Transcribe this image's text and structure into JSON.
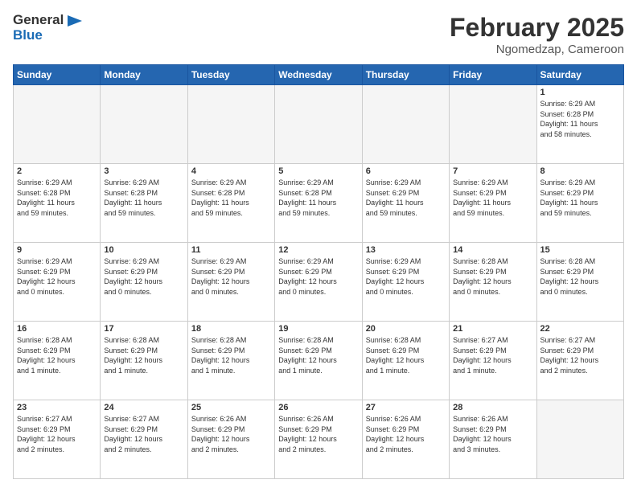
{
  "logo": {
    "line1": "General",
    "line2": "Blue"
  },
  "title": "February 2025",
  "location": "Ngomedzap, Cameroon",
  "days_header": [
    "Sunday",
    "Monday",
    "Tuesday",
    "Wednesday",
    "Thursday",
    "Friday",
    "Saturday"
  ],
  "weeks": [
    [
      {
        "day": "",
        "info": ""
      },
      {
        "day": "",
        "info": ""
      },
      {
        "day": "",
        "info": ""
      },
      {
        "day": "",
        "info": ""
      },
      {
        "day": "",
        "info": ""
      },
      {
        "day": "",
        "info": ""
      },
      {
        "day": "1",
        "info": "Sunrise: 6:29 AM\nSunset: 6:28 PM\nDaylight: 11 hours\nand 58 minutes."
      }
    ],
    [
      {
        "day": "2",
        "info": "Sunrise: 6:29 AM\nSunset: 6:28 PM\nDaylight: 11 hours\nand 59 minutes."
      },
      {
        "day": "3",
        "info": "Sunrise: 6:29 AM\nSunset: 6:28 PM\nDaylight: 11 hours\nand 59 minutes."
      },
      {
        "day": "4",
        "info": "Sunrise: 6:29 AM\nSunset: 6:28 PM\nDaylight: 11 hours\nand 59 minutes."
      },
      {
        "day": "5",
        "info": "Sunrise: 6:29 AM\nSunset: 6:28 PM\nDaylight: 11 hours\nand 59 minutes."
      },
      {
        "day": "6",
        "info": "Sunrise: 6:29 AM\nSunset: 6:29 PM\nDaylight: 11 hours\nand 59 minutes."
      },
      {
        "day": "7",
        "info": "Sunrise: 6:29 AM\nSunset: 6:29 PM\nDaylight: 11 hours\nand 59 minutes."
      },
      {
        "day": "8",
        "info": "Sunrise: 6:29 AM\nSunset: 6:29 PM\nDaylight: 11 hours\nand 59 minutes."
      }
    ],
    [
      {
        "day": "9",
        "info": "Sunrise: 6:29 AM\nSunset: 6:29 PM\nDaylight: 12 hours\nand 0 minutes."
      },
      {
        "day": "10",
        "info": "Sunrise: 6:29 AM\nSunset: 6:29 PM\nDaylight: 12 hours\nand 0 minutes."
      },
      {
        "day": "11",
        "info": "Sunrise: 6:29 AM\nSunset: 6:29 PM\nDaylight: 12 hours\nand 0 minutes."
      },
      {
        "day": "12",
        "info": "Sunrise: 6:29 AM\nSunset: 6:29 PM\nDaylight: 12 hours\nand 0 minutes."
      },
      {
        "day": "13",
        "info": "Sunrise: 6:29 AM\nSunset: 6:29 PM\nDaylight: 12 hours\nand 0 minutes."
      },
      {
        "day": "14",
        "info": "Sunrise: 6:28 AM\nSunset: 6:29 PM\nDaylight: 12 hours\nand 0 minutes."
      },
      {
        "day": "15",
        "info": "Sunrise: 6:28 AM\nSunset: 6:29 PM\nDaylight: 12 hours\nand 0 minutes."
      }
    ],
    [
      {
        "day": "16",
        "info": "Sunrise: 6:28 AM\nSunset: 6:29 PM\nDaylight: 12 hours\nand 1 minute."
      },
      {
        "day": "17",
        "info": "Sunrise: 6:28 AM\nSunset: 6:29 PM\nDaylight: 12 hours\nand 1 minute."
      },
      {
        "day": "18",
        "info": "Sunrise: 6:28 AM\nSunset: 6:29 PM\nDaylight: 12 hours\nand 1 minute."
      },
      {
        "day": "19",
        "info": "Sunrise: 6:28 AM\nSunset: 6:29 PM\nDaylight: 12 hours\nand 1 minute."
      },
      {
        "day": "20",
        "info": "Sunrise: 6:28 AM\nSunset: 6:29 PM\nDaylight: 12 hours\nand 1 minute."
      },
      {
        "day": "21",
        "info": "Sunrise: 6:27 AM\nSunset: 6:29 PM\nDaylight: 12 hours\nand 1 minute."
      },
      {
        "day": "22",
        "info": "Sunrise: 6:27 AM\nSunset: 6:29 PM\nDaylight: 12 hours\nand 2 minutes."
      }
    ],
    [
      {
        "day": "23",
        "info": "Sunrise: 6:27 AM\nSunset: 6:29 PM\nDaylight: 12 hours\nand 2 minutes."
      },
      {
        "day": "24",
        "info": "Sunrise: 6:27 AM\nSunset: 6:29 PM\nDaylight: 12 hours\nand 2 minutes."
      },
      {
        "day": "25",
        "info": "Sunrise: 6:26 AM\nSunset: 6:29 PM\nDaylight: 12 hours\nand 2 minutes."
      },
      {
        "day": "26",
        "info": "Sunrise: 6:26 AM\nSunset: 6:29 PM\nDaylight: 12 hours\nand 2 minutes."
      },
      {
        "day": "27",
        "info": "Sunrise: 6:26 AM\nSunset: 6:29 PM\nDaylight: 12 hours\nand 2 minutes."
      },
      {
        "day": "28",
        "info": "Sunrise: 6:26 AM\nSunset: 6:29 PM\nDaylight: 12 hours\nand 3 minutes."
      },
      {
        "day": "",
        "info": ""
      }
    ]
  ]
}
